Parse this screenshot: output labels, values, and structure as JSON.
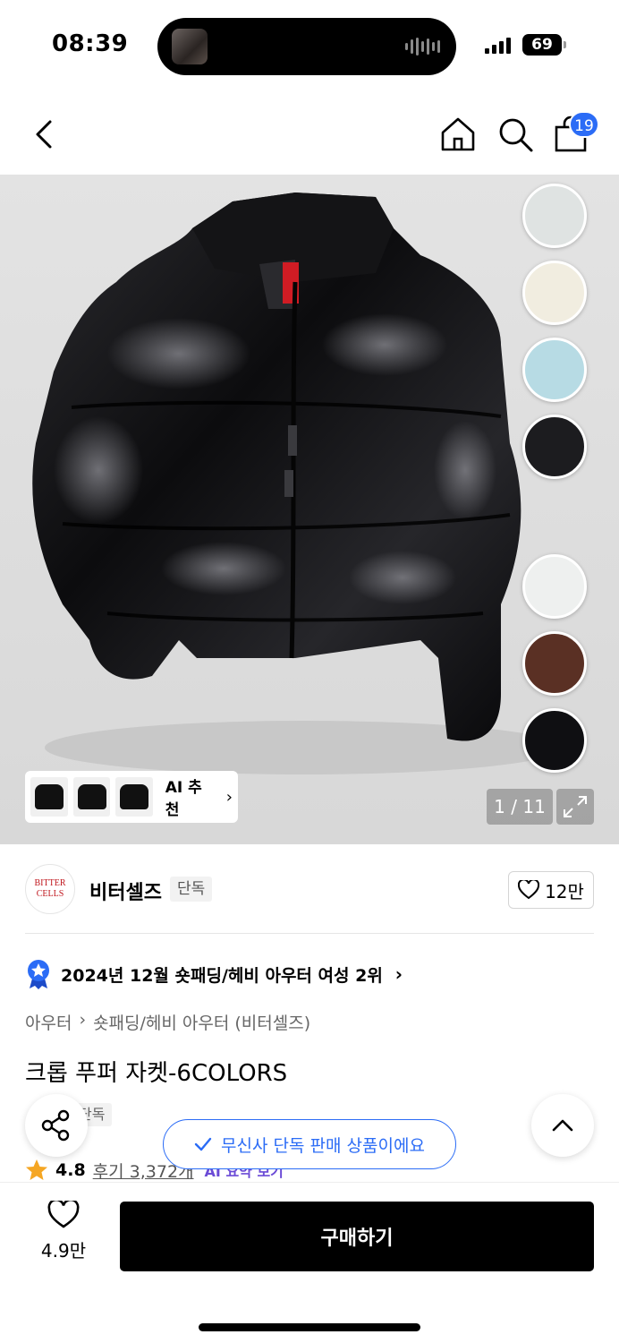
{
  "status_bar": {
    "time": "08:39",
    "battery": "69"
  },
  "nav": {
    "cart_count": "19"
  },
  "gallery": {
    "counter": "1 / 11",
    "ai_recommend_label": "AI 추천",
    "swatch_colors": [
      "#dfe3e2",
      "#f1ede0",
      "#b7dbe4",
      "#1c1c1f",
      "#eef0ef",
      "#5a3024",
      "#0f0f12"
    ]
  },
  "brand": {
    "logo_text_1": "BITTER",
    "logo_text_2": "CELLS",
    "name": "비터셀즈",
    "tag": "단독",
    "likes": "12만"
  },
  "ranking": {
    "text": "2024년 12월 숏패딩/헤비 아우터 여성 2위"
  },
  "breadcrumb": {
    "category": "아우터",
    "subcategory": "숏패딩/헤비 아우터 (비터셀즈)"
  },
  "product": {
    "title": "크롭 푸퍼 자켓-6COLORS",
    "exclusive_tag": "단독",
    "rating": "4.8",
    "reviews": "후기 3,372개",
    "ai_summary": "AI 요약 보기"
  },
  "toast": {
    "text": "무신사 단독 판매 상품이에요"
  },
  "bottom": {
    "wish_count": "4.9만",
    "buy_label": "구매하기"
  },
  "colors": {
    "accent": "#2b6cf6",
    "buy_bg": "#000000",
    "star": "#f5a623"
  }
}
